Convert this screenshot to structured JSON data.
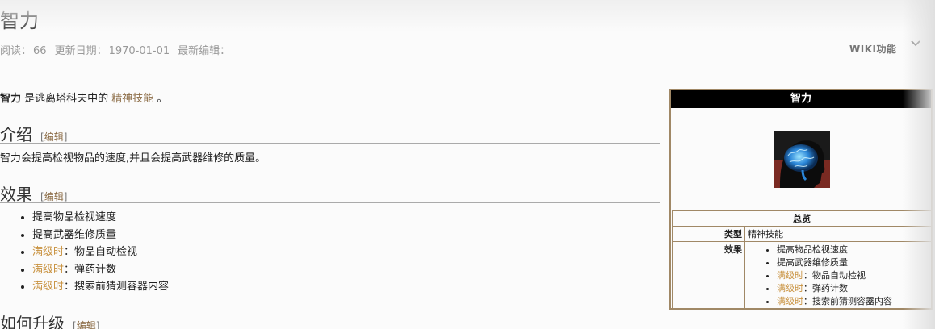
{
  "page": {
    "title": "智力",
    "meta": {
      "views_label": "阅读：",
      "views": "66",
      "updated_label": "更新日期：",
      "updated": "1970-01-01",
      "editor_label": "最新编辑："
    },
    "wiki_functions": "WIKI功能"
  },
  "intro": {
    "subject": "智力",
    "text_before_link": " 是逃离塔科夫中的 ",
    "link": "精神技能",
    "text_after_link": " 。"
  },
  "sections": {
    "intro_heading": "介绍",
    "edit_link": "编辑",
    "intro_text": "智力会提高检视物品的速度,并且会提高武器维修的质量。",
    "effects_heading": "效果",
    "upgrade_heading": "如何升级"
  },
  "effects": [
    {
      "prefix": "",
      "text": "提高物品检视速度"
    },
    {
      "prefix": "",
      "text": "提高武器维修质量"
    },
    {
      "prefix": "满级时",
      "text": "：物品自动检视"
    },
    {
      "prefix": "满级时",
      "text": "：弹药计数"
    },
    {
      "prefix": "满级时",
      "text": "：搜索前猜测容器内容"
    }
  ],
  "infobox": {
    "title": "智力",
    "image_icon": "brain-icon",
    "overview": "总览",
    "type_label": "类型",
    "type_value": "精神技能",
    "effects_label": "效果",
    "effects": [
      {
        "prefix": "",
        "text": "提高物品检视速度"
      },
      {
        "prefix": "",
        "text": "提高武器维修质量"
      },
      {
        "prefix": "满级时",
        "text": "：物品自动检视"
      },
      {
        "prefix": "满级时",
        "text": "：弹药计数"
      },
      {
        "prefix": "满级时",
        "text": "：搜索前猜测容器内容"
      }
    ]
  },
  "colors": {
    "link": "#8a6a43",
    "max_level": "#c8913e",
    "infobox_border": "#a08866",
    "infobox_header": "#000000"
  }
}
